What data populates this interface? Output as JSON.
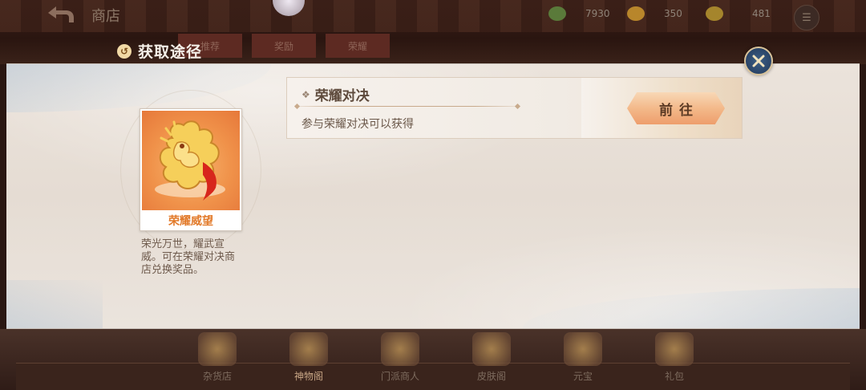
{
  "background": {
    "shop_title": "商店",
    "currencies": [
      {
        "icon": "jade-icon",
        "value": "7930"
      },
      {
        "icon": "gold-token-icon",
        "value": "350"
      },
      {
        "icon": "coin-icon",
        "value": "481"
      }
    ],
    "menu_label": "",
    "top_tabs": [
      "推荐",
      "奖励",
      "荣耀"
    ],
    "bottom_nav": [
      {
        "label": "杂货店",
        "icon": "grocery-icon"
      },
      {
        "label": "神物阁",
        "icon": "divine-items-icon",
        "active": true
      },
      {
        "label": "门派商人",
        "icon": "sect-merchant-icon"
      },
      {
        "label": "皮肤阁",
        "icon": "skin-shop-icon"
      },
      {
        "label": "元宝",
        "icon": "ingot-icon"
      },
      {
        "label": "礼包",
        "icon": "gift-pack-icon"
      }
    ]
  },
  "popup": {
    "title": "获取途径",
    "title_icon": "source-icon",
    "close_icon": "close-icon",
    "item": {
      "name": "荣耀威望",
      "image": "golden-dragon-icon",
      "description": "荣光万世，耀武宣威。可在荣耀对决商店兑换奖品。"
    },
    "sources": [
      {
        "name": "荣耀对决",
        "description": "参与荣耀对决可以获得",
        "button_label": "前往"
      }
    ]
  },
  "colors": {
    "accent_orange": "#e27a2a",
    "button_gradient_top": "#f8d8b6",
    "button_gradient_bottom": "#ee9e6c",
    "panel_bg": "#e8e0d8",
    "close_button": "#2d4a70"
  }
}
